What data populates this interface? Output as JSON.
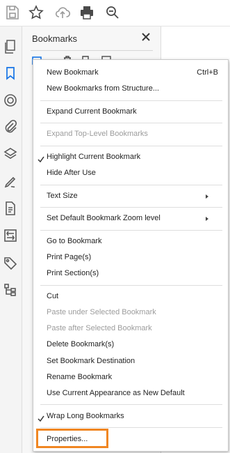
{
  "toolbar": {
    "icons": [
      "save-icon",
      "star-icon",
      "cloud-upload-icon",
      "print-icon",
      "zoom-icon"
    ]
  },
  "leftbar": {
    "icons": [
      "pages-icon",
      "bookmark-icon",
      "target-icon",
      "attachment-icon",
      "layers-icon",
      "signature-icon",
      "document-icon",
      "compare-icon",
      "tag-icon",
      "structure-icon"
    ]
  },
  "panel": {
    "title": "Bookmarks"
  },
  "menu": {
    "items": [
      {
        "label": "New Bookmark",
        "shortcut": "Ctrl+B",
        "enabled": true
      },
      {
        "label": "New Bookmarks from Structure...",
        "enabled": true
      },
      {
        "label": "Expand Current Bookmark",
        "enabled": true
      },
      {
        "label": "Expand Top-Level Bookmarks",
        "enabled": false
      },
      {
        "label": "Highlight Current Bookmark",
        "checked": true,
        "enabled": true
      },
      {
        "label": "Hide After Use",
        "enabled": true
      },
      {
        "label": "Text Size",
        "submenu": true,
        "enabled": true
      },
      {
        "label": "Set Default Bookmark Zoom level",
        "submenu": true,
        "enabled": true
      },
      {
        "label": "Go to Bookmark",
        "enabled": true
      },
      {
        "label": "Print Page(s)",
        "enabled": true
      },
      {
        "label": "Print Section(s)",
        "enabled": true
      },
      {
        "label": "Cut",
        "enabled": true
      },
      {
        "label": "Paste under Selected Bookmark",
        "enabled": false
      },
      {
        "label": "Paste after Selected Bookmark",
        "enabled": false
      },
      {
        "label": "Delete Bookmark(s)",
        "enabled": true
      },
      {
        "label": "Set Bookmark Destination",
        "enabled": true
      },
      {
        "label": "Rename Bookmark",
        "enabled": true
      },
      {
        "label": "Use Current Appearance as New Default",
        "enabled": true
      },
      {
        "label": "Wrap Long Bookmarks",
        "checked": true,
        "enabled": true
      },
      {
        "label": "Properties...",
        "enabled": true,
        "highlighted": true
      }
    ]
  },
  "colors": {
    "highlight_border": "#f08622",
    "disabled_text": "#9c9c9c",
    "icon": "#5a5a5a"
  }
}
